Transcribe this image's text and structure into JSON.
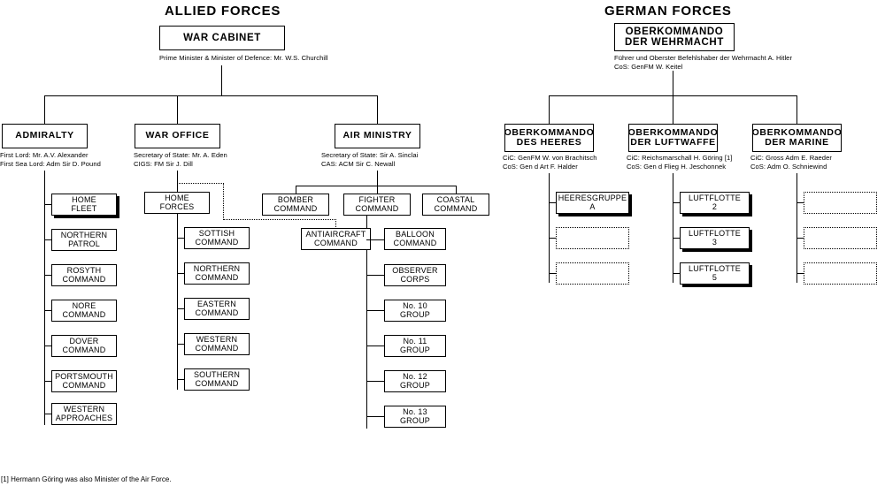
{
  "headings": {
    "allied": "ALLIED FORCES",
    "german": "GERMAN FORCES"
  },
  "footnote": "[1] Hermann Göring was also Minister of the Air Force.",
  "allied": {
    "top": {
      "label": "WAR CABINET",
      "subtext": "Prime Minister & Minister of Defence:  Mr. W.S. Churchill"
    },
    "branches": [
      {
        "label": "ADMIRALTY",
        "subtext": "First Lord:  Mr. A.V. Alexander\nFirst Sea Lord:  Adm Sir D. Pound",
        "children": [
          {
            "label": "HOME\nFLEET",
            "highlight": true
          },
          {
            "label": "NORTHERN\nPATROL",
            "highlight": false
          },
          {
            "label": "ROSYTH\nCOMMAND",
            "highlight": false
          },
          {
            "label": "NORE\nCOMMAND",
            "highlight": false
          },
          {
            "label": "DOVER\nCOMMAND",
            "highlight": false
          },
          {
            "label": "PORTSMOUTH\nCOMMAND",
            "highlight": false
          },
          {
            "label": "WESTERN\nAPPROACHES",
            "highlight": false
          }
        ]
      },
      {
        "label": "WAR OFFICE",
        "subtext": "Secretary of State:  Mr. A. Eden\nCIGS:  FM Sir J. Dill",
        "command": "HOME\nFORCES",
        "children": [
          {
            "label": "SOTTISH\nCOMMAND",
            "highlight": false
          },
          {
            "label": "NORTHERN\nCOMMAND",
            "highlight": false
          },
          {
            "label": "EASTERN\nCOMMAND",
            "highlight": false
          },
          {
            "label": "WESTERN\nCOMMAND",
            "highlight": false
          },
          {
            "label": "SOUTHERN\nCOMMAND",
            "highlight": false
          }
        ]
      },
      {
        "label": "AIR MINISTRY",
        "subtext": "Secretary of State:  Sir A. Sinclai\nCAS:  ACM  Sir C. Newall",
        "commands": [
          {
            "label": "BOMBER\nCOMMAND"
          },
          {
            "label": "FIGHTER\nCOMMAND"
          },
          {
            "label": "COASTAL\nCOMMAND"
          }
        ],
        "antiaircraft": "ANTIAIRCRAFT\nCOMMAND",
        "children": [
          {
            "label": "BALLOON\nCOMMAND",
            "highlight": false
          },
          {
            "label": "OBSERVER\nCORPS",
            "highlight": false
          },
          {
            "label": "No. 10\nGROUP",
            "highlight": false
          },
          {
            "label": "No. 11\nGROUP",
            "highlight": false
          },
          {
            "label": "No. 12\nGROUP",
            "highlight": false
          },
          {
            "label": "No. 13\nGROUP",
            "highlight": false
          }
        ]
      }
    ]
  },
  "german": {
    "top": {
      "label": "OBERKOMMANDO\nDER WEHRMACHT",
      "subtext": "Führer und Oberster Befehlshaber der Wehrmacht  A. Hitler\nCoS:  GenFM  W. Keitel"
    },
    "branches": [
      {
        "label": "OBERKOMMANDO\nDES HEERES",
        "subtext": "CiC:  GenFM  W. von Brachitsch\nCoS: Gen d Art  F. Halder",
        "children": [
          {
            "label": "HEERESGRUPPE\nA",
            "highlight": true,
            "empty": false
          },
          {
            "label": "",
            "highlight": false,
            "empty": true
          },
          {
            "label": "",
            "highlight": false,
            "empty": true
          }
        ]
      },
      {
        "label": "OBERKOMMANDO\nDER LUFTWAFFE",
        "subtext": "CiC:  Reichsmarschall H. Göring [1]\nCoS: Gen d Flieg  H. Jeschonnek",
        "children": [
          {
            "label": "LUFTFLOTTE\n2",
            "highlight": true,
            "empty": false
          },
          {
            "label": "LUFTFLOTTE\n3",
            "highlight": true,
            "empty": false
          },
          {
            "label": "LUFTFLOTTE\n5",
            "highlight": true,
            "empty": false
          }
        ]
      },
      {
        "label": "OBERKOMMANDO\nDER MARINE",
        "subtext": "CiC:  Gross Adm  E. Raeder\nCoS: Adm O. Schniewind",
        "children": [
          {
            "label": "",
            "highlight": false,
            "empty": true
          },
          {
            "label": "",
            "highlight": false,
            "empty": true
          },
          {
            "label": "",
            "highlight": false,
            "empty": true
          }
        ]
      }
    ]
  }
}
